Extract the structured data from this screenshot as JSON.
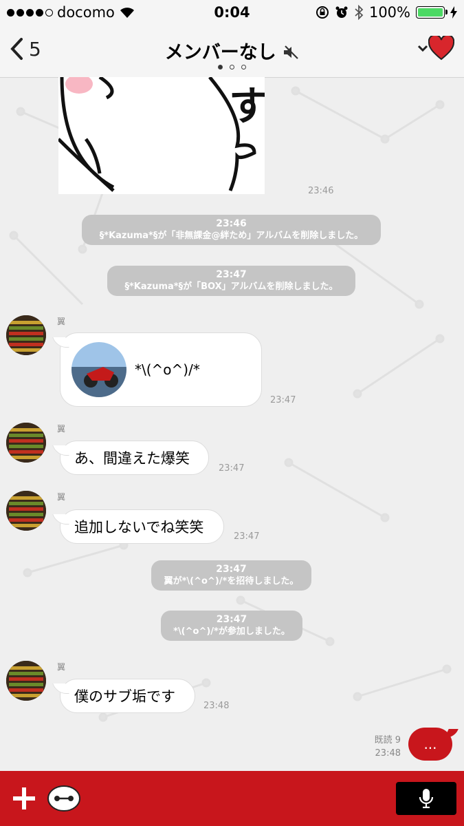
{
  "status_bar": {
    "carrier": "docomo",
    "time": "0:04",
    "battery": "100%"
  },
  "nav": {
    "back_count": "5",
    "title": "メンバーなし"
  },
  "messages": {
    "sticker_time": "23:46",
    "system1": {
      "time": "23:46",
      "text": "§*Kazuma*§が「非無課金@絆ため」アルバムを削除しました。"
    },
    "system2": {
      "time": "23:47",
      "text": "§*Kazuma*§が「BOX」アルバムを削除しました。"
    },
    "msg1": {
      "sender": "翼",
      "text": "*\\(^o^)/*",
      "time": "23:47"
    },
    "msg2": {
      "sender": "翼",
      "text": "あ、間違えた爆笑",
      "time": "23:47"
    },
    "msg3": {
      "sender": "翼",
      "text": "追加しないでね笑笑",
      "time": "23:47"
    },
    "system3": {
      "time": "23:47",
      "text": "翼が*\\(^o^)/*を招待しました。"
    },
    "system4": {
      "time": "23:47",
      "text": "*\\(^o^)/*が参加しました。"
    },
    "msg4": {
      "sender": "翼",
      "text": "僕のサブ垢です",
      "time": "23:48"
    },
    "mine": {
      "read": "既読 9",
      "time": "23:48",
      "text": "..."
    }
  },
  "colors": {
    "accent": "#c8161c",
    "system_bg": "#c5c5c5",
    "battery": "#4cd964"
  }
}
